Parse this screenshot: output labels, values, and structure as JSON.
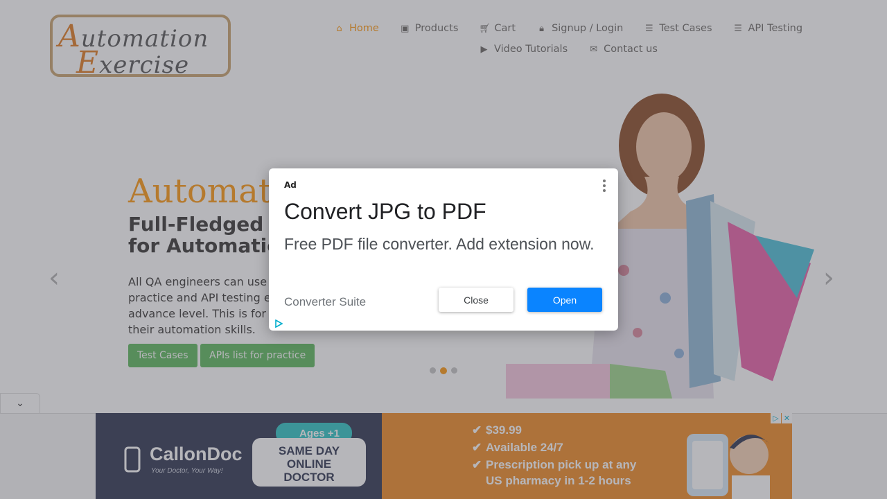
{
  "header": {
    "logo": {
      "line1_cap": "A",
      "line1_rest": "utomation",
      "line2_cap": "E",
      "line2_rest": "xercise"
    },
    "nav": [
      {
        "label": "Home",
        "icon": "home-icon",
        "active": true
      },
      {
        "label": "Products",
        "icon": "briefcase-icon",
        "active": false
      },
      {
        "label": "Cart",
        "icon": "cart-icon",
        "active": false
      },
      {
        "label": "Signup / Login",
        "icon": "lock-icon",
        "active": false
      },
      {
        "label": "Test Cases",
        "icon": "list-icon",
        "active": false
      },
      {
        "label": "API Testing",
        "icon": "list-icon",
        "active": false
      },
      {
        "label": "Video Tutorials",
        "icon": "youtube-icon",
        "active": false
      },
      {
        "label": "Contact us",
        "icon": "envelope-icon",
        "active": false
      }
    ]
  },
  "slider": {
    "title": "Automat",
    "subtitle_line1": "Full-Fledged",
    "subtitle_line2": "for Automatic",
    "text": "All QA engineers can use\npractice and API testing e\nadvance level. This is for\ntheir automation skills.",
    "btn_test_cases": "Test Cases",
    "btn_apis": "APIs list for practice",
    "prev_icon": "chevron-left-icon",
    "next_icon": "chevron-right-icon",
    "dots": 3,
    "active_dot": 1
  },
  "modal": {
    "tag": "Ad",
    "title": "Convert JPG to PDF",
    "description": "Free PDF file converter. Add extension now.",
    "brand": "Converter Suite",
    "close_label": "Close",
    "open_label": "Open",
    "accent": "#0a84ff"
  },
  "banner": {
    "brand": "CallonDoc",
    "tagline": "Your Doctor, Your Way!",
    "ages": "Ages +1",
    "sameday_lines": [
      "SAME DAY",
      "ONLINE",
      "DOCTOR"
    ],
    "features": [
      "$39.99",
      "Available 24/7",
      "Prescription pick up at any",
      "US pharmacy in 1-2 hours"
    ]
  },
  "colors": {
    "accent": "#fe980f",
    "green": "#5cb85c"
  }
}
